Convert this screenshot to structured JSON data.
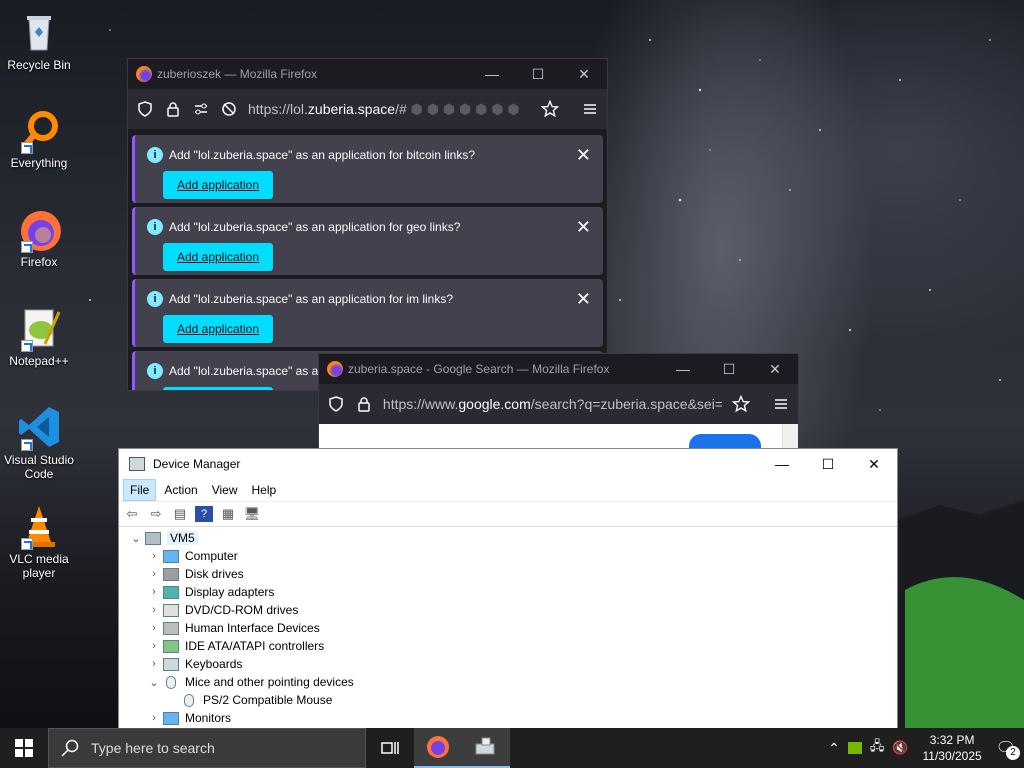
{
  "desktop": {
    "icons": [
      {
        "label": "Recycle Bin"
      },
      {
        "label": "Everything"
      },
      {
        "label": "Firefox"
      },
      {
        "label": "Notepad++"
      },
      {
        "label": "Visual Studio Code"
      },
      {
        "label": "VLC media player"
      }
    ]
  },
  "firefox1": {
    "title": "zuberioszek — Mozilla Firefox",
    "url_prefix": "https://lol.",
    "url_domain": "zuberia.space",
    "url_suffix": "/#",
    "notifications": [
      {
        "message": "Add \"lol.zuberia.space\" as an application for bitcoin links?",
        "button": "Add application"
      },
      {
        "message": "Add \"lol.zuberia.space\" as an application for geo links?",
        "button": "Add application"
      },
      {
        "message": "Add \"lol.zuberia.space\" as an application for im links?",
        "button": "Add application"
      },
      {
        "message": "Add \"lol.zuberia.space\" as an an",
        "button": ""
      }
    ]
  },
  "firefox2": {
    "title": "zuberia.space - Google Search — Mozilla Firefox",
    "url_prefix": "https://www.",
    "url_domain": "google.com",
    "url_suffix": "/search?q=zuberia.space&sei="
  },
  "device_manager": {
    "title": "Device Manager",
    "menu": [
      "File",
      "Action",
      "View",
      "Help"
    ],
    "root": "VM5",
    "tree": [
      {
        "label": "Computer",
        "expanded": false
      },
      {
        "label": "Disk drives",
        "expanded": false
      },
      {
        "label": "Display adapters",
        "expanded": false
      },
      {
        "label": "DVD/CD-ROM drives",
        "expanded": false
      },
      {
        "label": "Human Interface Devices",
        "expanded": false
      },
      {
        "label": "IDE ATA/ATAPI controllers",
        "expanded": false
      },
      {
        "label": "Keyboards",
        "expanded": false
      },
      {
        "label": "Mice and other pointing devices",
        "expanded": true
      },
      {
        "label": "PS/2 Compatible Mouse",
        "child": true
      },
      {
        "label": "Monitors",
        "expanded": false
      }
    ]
  },
  "taskbar": {
    "search_placeholder": "Type here to search",
    "time": "3:32 PM",
    "date": "11/30/2025",
    "notification_count": "2"
  }
}
